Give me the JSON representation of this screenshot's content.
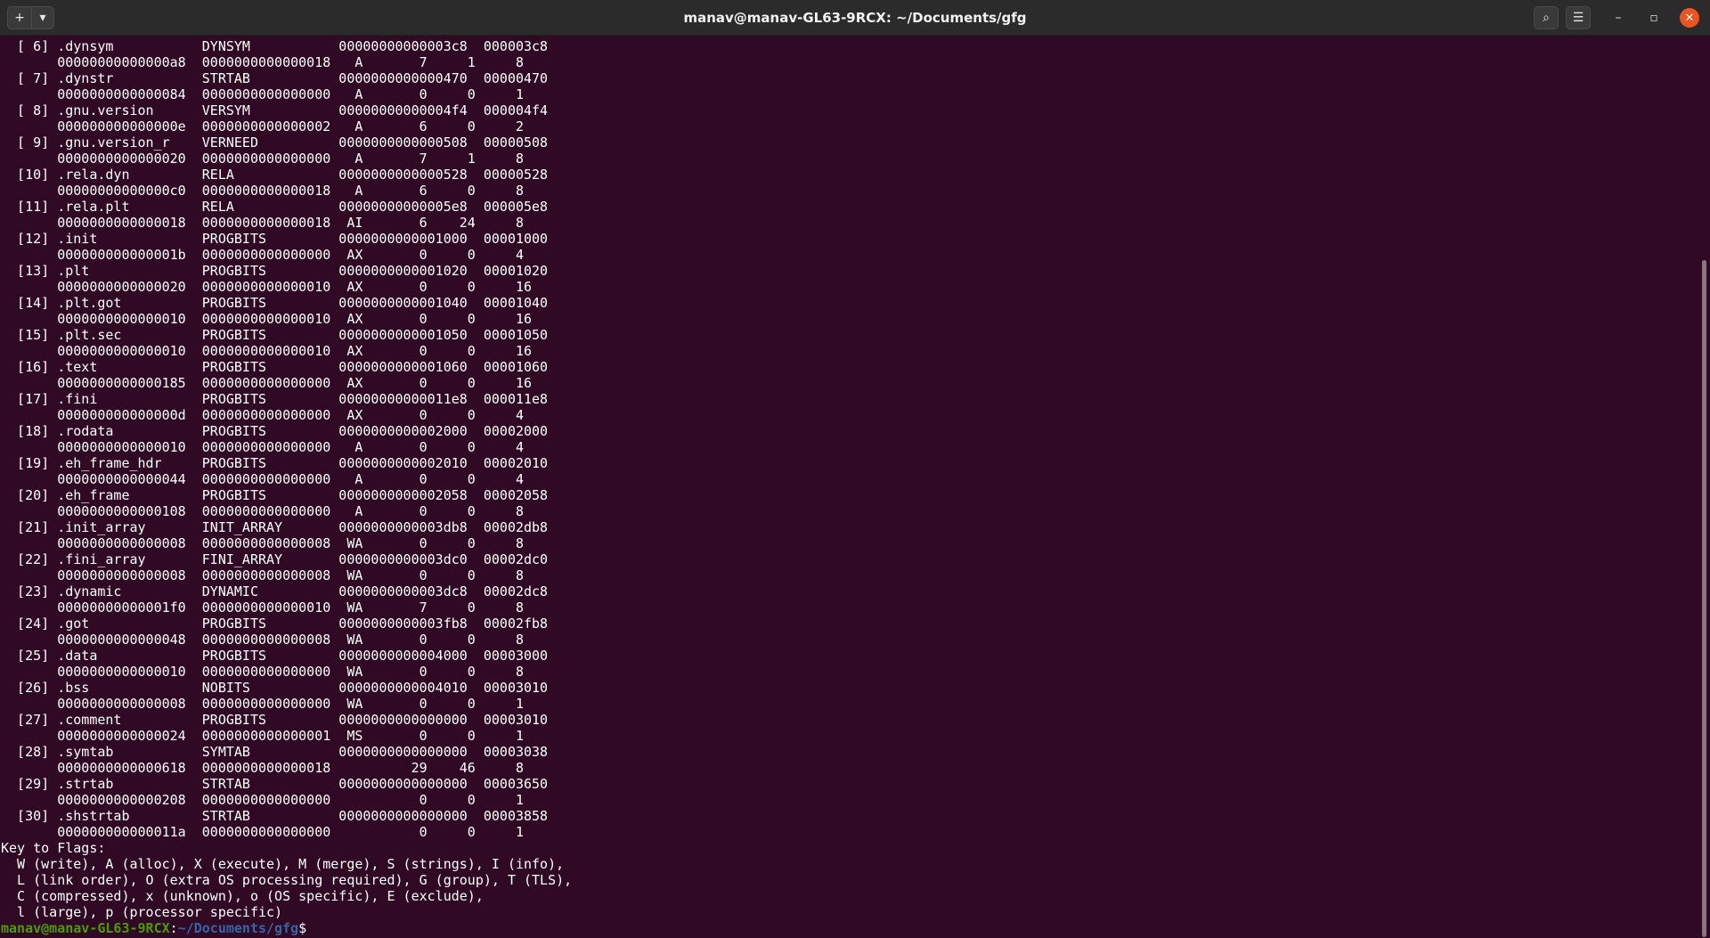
{
  "window": {
    "title": "manav@manav-GL63-9RCX: ~/Documents/gfg",
    "new_tab_icon": "+",
    "tab_menu_icon": "▾",
    "search_icon": "⌕",
    "menu_icon": "☰",
    "minimize_icon": "–",
    "maximize_icon": "▫",
    "close_icon": "✕"
  },
  "terminal": {
    "lines": [
      "  [ 6] .dynsym           DYNSYM           00000000000003c8  000003c8",
      "       00000000000000a8  0000000000000018   A       7     1     8",
      "  [ 7] .dynstr           STRTAB           0000000000000470  00000470",
      "       0000000000000084  0000000000000000   A       0     0     1",
      "  [ 8] .gnu.version      VERSYM           00000000000004f4  000004f4",
      "       000000000000000e  0000000000000002   A       6     0     2",
      "  [ 9] .gnu.version_r    VERNEED          0000000000000508  00000508",
      "       0000000000000020  0000000000000000   A       7     1     8",
      "  [10] .rela.dyn         RELA             0000000000000528  00000528",
      "       00000000000000c0  0000000000000018   A       6     0     8",
      "  [11] .rela.plt         RELA             00000000000005e8  000005e8",
      "       0000000000000018  0000000000000018  AI       6    24     8",
      "  [12] .init             PROGBITS         0000000000001000  00001000",
      "       000000000000001b  0000000000000000  AX       0     0     4",
      "  [13] .plt              PROGBITS         0000000000001020  00001020",
      "       0000000000000020  0000000000000010  AX       0     0     16",
      "  [14] .plt.got          PROGBITS         0000000000001040  00001040",
      "       0000000000000010  0000000000000010  AX       0     0     16",
      "  [15] .plt.sec          PROGBITS         0000000000001050  00001050",
      "       0000000000000010  0000000000000010  AX       0     0     16",
      "  [16] .text             PROGBITS         0000000000001060  00001060",
      "       0000000000000185  0000000000000000  AX       0     0     16",
      "  [17] .fini             PROGBITS         00000000000011e8  000011e8",
      "       000000000000000d  0000000000000000  AX       0     0     4",
      "  [18] .rodata           PROGBITS         0000000000002000  00002000",
      "       0000000000000010  0000000000000000   A       0     0     4",
      "  [19] .eh_frame_hdr     PROGBITS         0000000000002010  00002010",
      "       0000000000000044  0000000000000000   A       0     0     4",
      "  [20] .eh_frame         PROGBITS         0000000000002058  00002058",
      "       0000000000000108  0000000000000000   A       0     0     8",
      "  [21] .init_array       INIT_ARRAY       0000000000003db8  00002db8",
      "       0000000000000008  0000000000000008  WA       0     0     8",
      "  [22] .fini_array       FINI_ARRAY       0000000000003dc0  00002dc0",
      "       0000000000000008  0000000000000008  WA       0     0     8",
      "  [23] .dynamic          DYNAMIC          0000000000003dc8  00002dc8",
      "       00000000000001f0  0000000000000010  WA       7     0     8",
      "  [24] .got              PROGBITS         0000000000003fb8  00002fb8",
      "       0000000000000048  0000000000000008  WA       0     0     8",
      "  [25] .data             PROGBITS         0000000000004000  00003000",
      "       0000000000000010  0000000000000000  WA       0     0     8",
      "  [26] .bss              NOBITS           0000000000004010  00003010",
      "       0000000000000008  0000000000000000  WA       0     0     1",
      "  [27] .comment          PROGBITS         0000000000000000  00003010",
      "       0000000000000024  0000000000000001  MS       0     0     1",
      "  [28] .symtab           SYMTAB           0000000000000000  00003038",
      "       0000000000000618  0000000000000018          29    46     8",
      "  [29] .strtab           STRTAB           0000000000000000  00003650",
      "       0000000000000208  0000000000000000           0     0     1",
      "  [30] .shstrtab         STRTAB           0000000000000000  00003858",
      "       000000000000011a  0000000000000000           0     0     1",
      "Key to Flags:",
      "  W (write), A (alloc), X (execute), M (merge), S (strings), I (info),",
      "  L (link order), O (extra OS processing required), G (group), T (TLS),",
      "  C (compressed), x (unknown), o (OS specific), E (exclude),",
      "  l (large), p (processor specific)"
    ],
    "prompt": {
      "user_host": "manav@manav-GL63-9RCX",
      "colon": ":",
      "path": "~/Documents/gfg",
      "symbol": "$"
    }
  }
}
